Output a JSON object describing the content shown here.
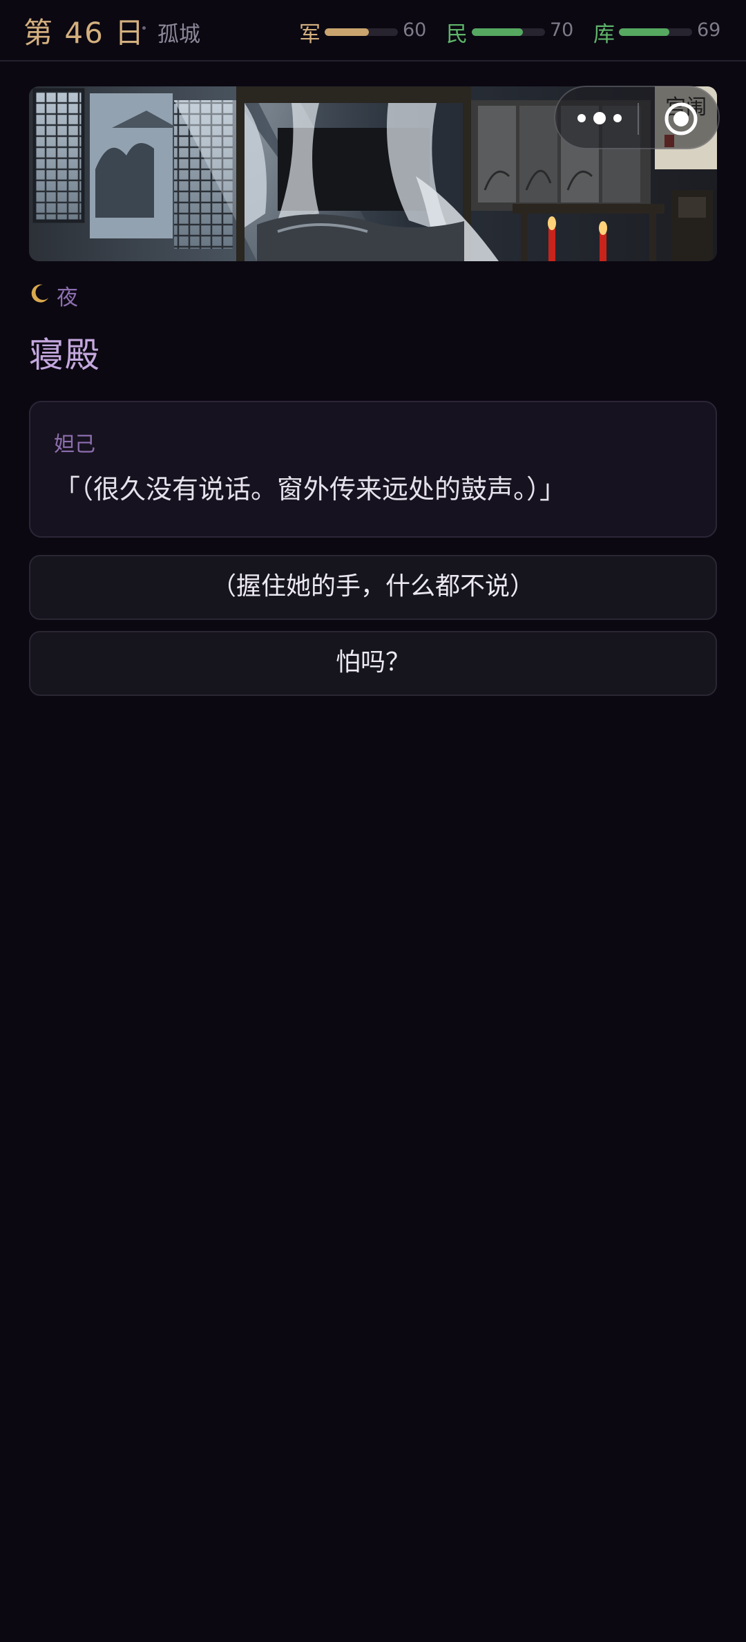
{
  "header": {
    "day": "第 46 日",
    "city": "孤城",
    "stats": [
      {
        "label": "军",
        "value": 60,
        "label_color": "#d4b07e",
        "bar_color": "#c9a46e"
      },
      {
        "label": "民",
        "value": 70,
        "label_color": "#5fb56a",
        "bar_color": "#56a860"
      },
      {
        "label": "库",
        "value": 69,
        "label_color": "#5fb56a",
        "bar_color": "#56a860"
      }
    ]
  },
  "scene": {
    "image_icon": "bedchamber-scene-illustration",
    "seal_text": "宫闱",
    "time_icon": "moon-icon",
    "time": "夜",
    "location": "寝殿"
  },
  "dialogue": {
    "speaker": "妲己",
    "text": "「（很久没有说话。窗外传来远处的鼓声。）」"
  },
  "choices": [
    {
      "label": "（握住她的手，什么都不说）"
    },
    {
      "label": "怕吗？"
    }
  ],
  "capsule": {
    "menu_icon": "more-dots-icon",
    "close_icon": "target-circle-icon"
  }
}
